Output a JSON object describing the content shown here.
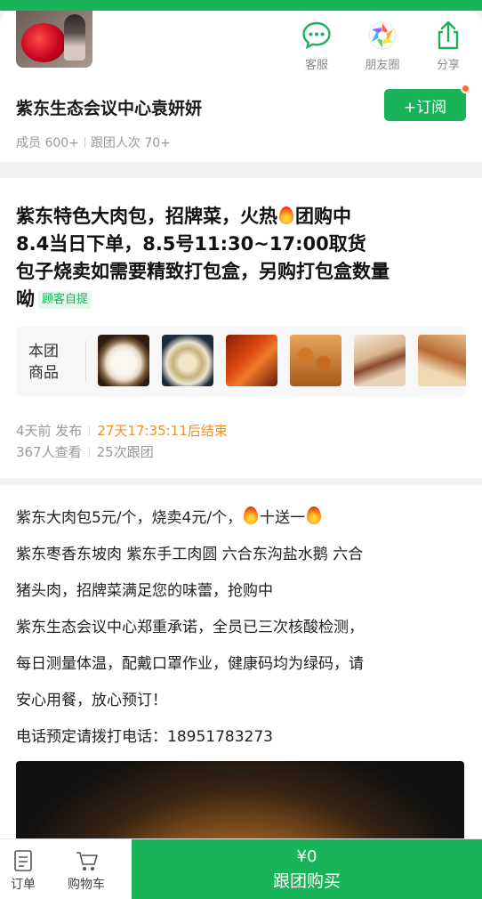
{
  "header": {
    "actions": [
      {
        "label": "客服",
        "icon": "chat-icon"
      },
      {
        "label": "朋友圈",
        "icon": "moments-icon"
      },
      {
        "label": "分享",
        "icon": "share-icon"
      }
    ],
    "group_name": "紫东生态会议中心袁妍妍",
    "subscribe_label": "+订阅",
    "stats": {
      "members": "成员 600+",
      "followers": "跟团人次 70+"
    }
  },
  "post": {
    "title_lines": [
      "紫东特色大肉包，招牌菜，火热",
      "团购中",
      "8.4当日下单，8.5号11:30~17:00取货",
      "包子烧卖如需要精致打包盒，另购打包盒数量",
      "呦"
    ],
    "pickup_badge": "顾客自提",
    "products_label": "本团商品",
    "product_count": 6,
    "meta": {
      "posted": "4天前 发布",
      "countdown": "27天17:35:11后结束",
      "views": "367人查看",
      "joins": "25次跟团"
    }
  },
  "description": {
    "lines": [
      "紫东大肉包5元/个，烧卖4元/个，",
      "十送一",
      "紫东枣香东坡肉 紫东手工肉圆 六合东沟盐水鹅 六合",
      "猪头肉，招牌菜满足您的味蕾，抢购中",
      "紫东生态会议中心郑重承诺，全员已三次核酸检测，",
      "每日测量体温，配戴口罩作业，健康码均为绿码，请",
      "安心用餐，放心预订！",
      "电话预定请拨打电话：18951783273"
    ]
  },
  "bottom": {
    "orders_label": "订单",
    "cart_label": "购物车",
    "price": "¥0",
    "buy_label": "跟团购买"
  },
  "colors": {
    "accent": "#19b35a",
    "countdown": "#f0902a",
    "badge_dot": "#ff6a2a"
  }
}
